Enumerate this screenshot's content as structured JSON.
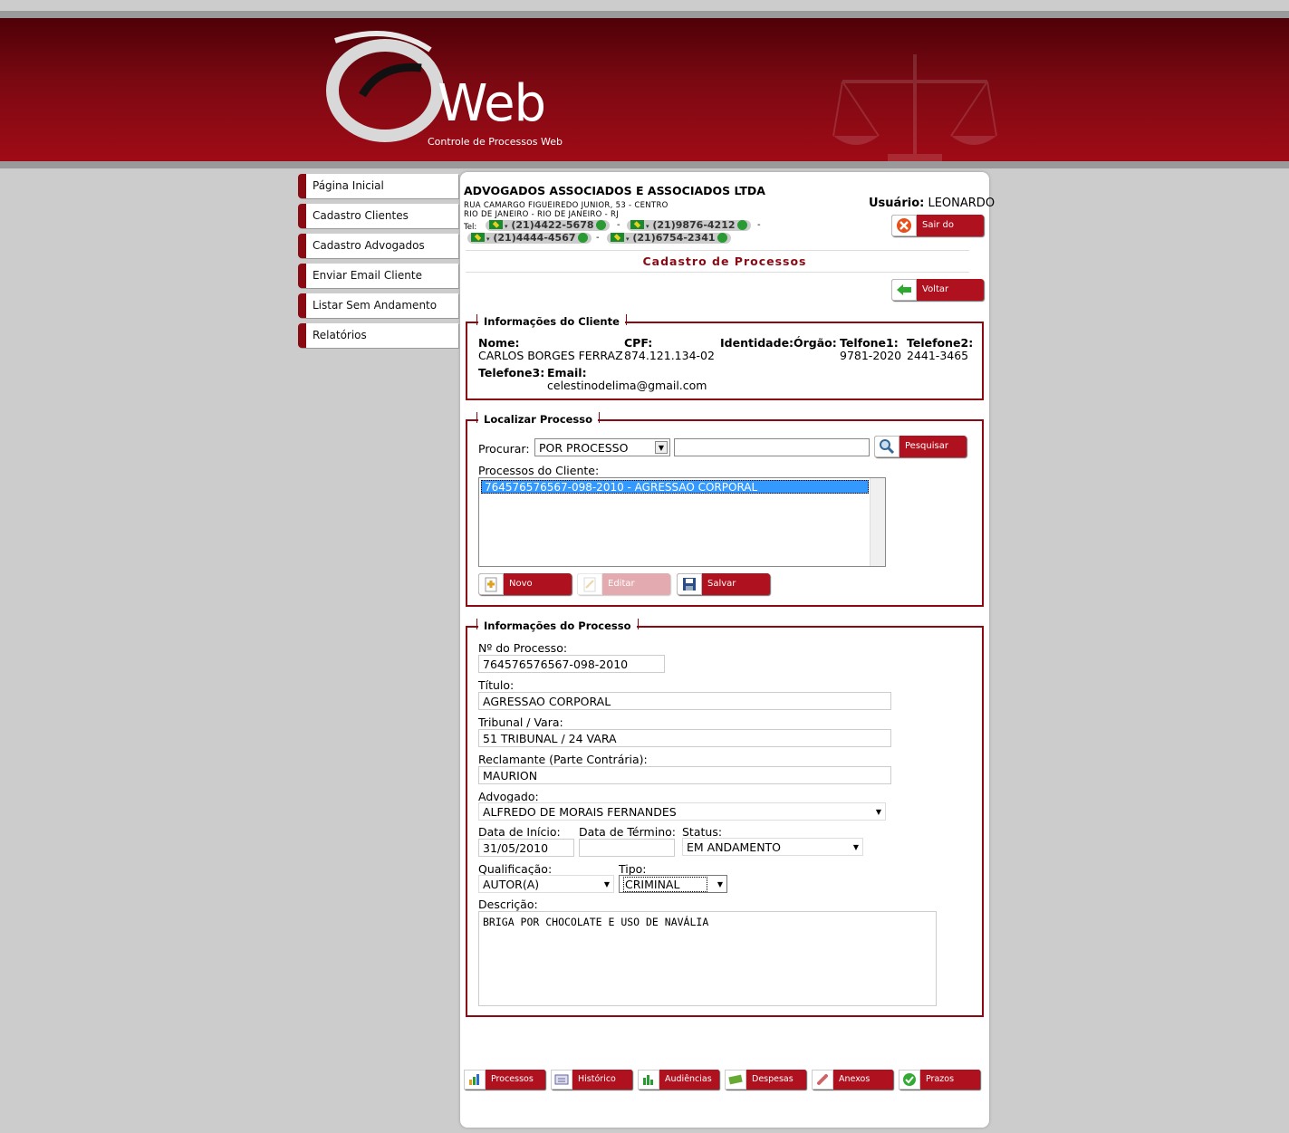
{
  "header": {
    "logo_text": "Web",
    "logo_subtitle": "Controle de Processos Web"
  },
  "menu": [
    {
      "label": "Página Inicial"
    },
    {
      "label": "Cadastro Clientes"
    },
    {
      "label": "Cadastro Advogados"
    },
    {
      "label": "Enviar Email Cliente"
    },
    {
      "label": "Listar Sem Andamento"
    },
    {
      "label": "Relatórios"
    }
  ],
  "company": {
    "name": "ADVOGADOS ASSOCIADOS E ASSOCIADOS LTDA",
    "address1": "RUA CAMARGO FIGUEIREDO JUNIOR, 53 - CENTRO",
    "address2": "RIO DE JANEIRO - RIO DE JANEIRO - RJ",
    "tel_label": "Tel:",
    "phones": [
      "(21)4422-5678",
      "(21)9876-4212",
      "(21)4444-4567",
      "(21)6754-2341"
    ],
    "separator": "-"
  },
  "user": {
    "label": "Usuário:",
    "name": "LEONARDO",
    "logout_label": "Sair do Sistema"
  },
  "page_title": "Cadastro de Processos",
  "back_label": "Voltar",
  "cliente": {
    "legend": "Informações do Cliente",
    "nome_label": "Nome:",
    "nome": "CARLOS BORGES FERRAZ",
    "cpf_label": "CPF:",
    "cpf": "874.121.134-02",
    "identidade_label": "Identidade:",
    "orgao_label": "Órgão:",
    "telefone1_label": "Telfone1:",
    "telefone1": "9781-2020",
    "telefone2_label": "Telefone2:",
    "telefone2": "2441-3465",
    "telefone3_label": "Telefone3:",
    "email_label": "Email:",
    "email": "celestinodelima@gmail.com"
  },
  "localizar": {
    "legend": "Localizar Processo",
    "procurar_label": "Procurar:",
    "procurar_value": "POR PROCESSO",
    "search_value": "",
    "pesquisar_label": "Pesquisar",
    "processos_label": "Processos do Cliente:",
    "processos": [
      "764576576567-098-2010 - AGRESSAO CORPORAL"
    ],
    "novo_label": "Novo",
    "editar_label": "Editar",
    "salvar_label": "Salvar"
  },
  "processo": {
    "legend": "Informações do Processo",
    "numero_label": "Nº do Processo:",
    "numero": "764576576567-098-2010",
    "titulo_label": "Título:",
    "titulo": "AGRESSAO CORPORAL",
    "tribunal_label": "Tribunal / Vara:",
    "tribunal": "51 TRIBUNAL / 24 VARA",
    "reclamante_label": "Reclamante (Parte Contrária):",
    "reclamante": "MAURION",
    "advogado_label": "Advogado:",
    "advogado": "ALFREDO DE MORAIS FERNANDES",
    "inicio_label": "Data de Início:",
    "inicio": "31/05/2010",
    "termino_label": "Data de Término:",
    "termino": "",
    "status_label": "Status:",
    "status": "EM ANDAMENTO",
    "qualificacao_label": "Qualificação:",
    "qualificacao": "AUTOR(A)",
    "tipo_label": "Tipo:",
    "tipo": "CRIMINAL",
    "descricao_label": "Descrição:",
    "descricao": "BRIGA POR CHOCOLATE E USO DE NAVÁLIA"
  },
  "bottom_tabs": [
    {
      "label": "Processos",
      "icon": "chart-icon"
    },
    {
      "label": "Histórico",
      "icon": "card-icon"
    },
    {
      "label": "Audiências",
      "icon": "bars-icon"
    },
    {
      "label": "Despesas",
      "icon": "money-icon"
    },
    {
      "label": "Anexos",
      "icon": "clip-icon"
    },
    {
      "label": "Prazos",
      "icon": "check-icon"
    }
  ],
  "colors": {
    "brand": "#8a0a14",
    "button": "#b0111f",
    "background": "#cccccc"
  }
}
